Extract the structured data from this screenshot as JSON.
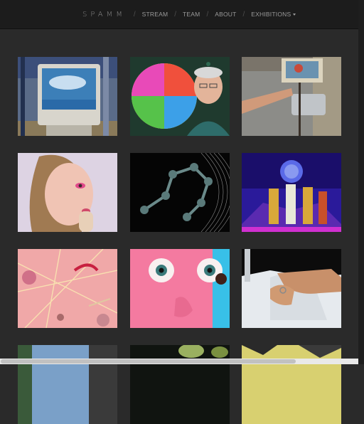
{
  "nav": {
    "brand": "SPAMM",
    "links": [
      {
        "label": "STREAM"
      },
      {
        "label": "TEAM"
      },
      {
        "label": "ABOUT"
      },
      {
        "label": "EXHIBITIONS"
      }
    ]
  },
  "tiles": [
    {
      "subject": "computer-monitor-on-stand"
    },
    {
      "subject": "color-wheel-and-man"
    },
    {
      "subject": "hand-painting-on-easel"
    },
    {
      "subject": "woman-with-pink-eye-makeup"
    },
    {
      "subject": "3d-molecule-on-black"
    },
    {
      "subject": "virus-figures-neon"
    },
    {
      "subject": "abstract-pink-lines"
    },
    {
      "subject": "pink-cartoon-face"
    },
    {
      "subject": "hands-washing-at-sink"
    },
    {
      "subject": "outdoor-partial"
    },
    {
      "subject": "plant-partial"
    },
    {
      "subject": "abstract-partial"
    }
  ],
  "colors": {
    "background": "#2a2a2a",
    "navbar": "#1c1c1c",
    "nav_text": "#9a9a9a"
  }
}
